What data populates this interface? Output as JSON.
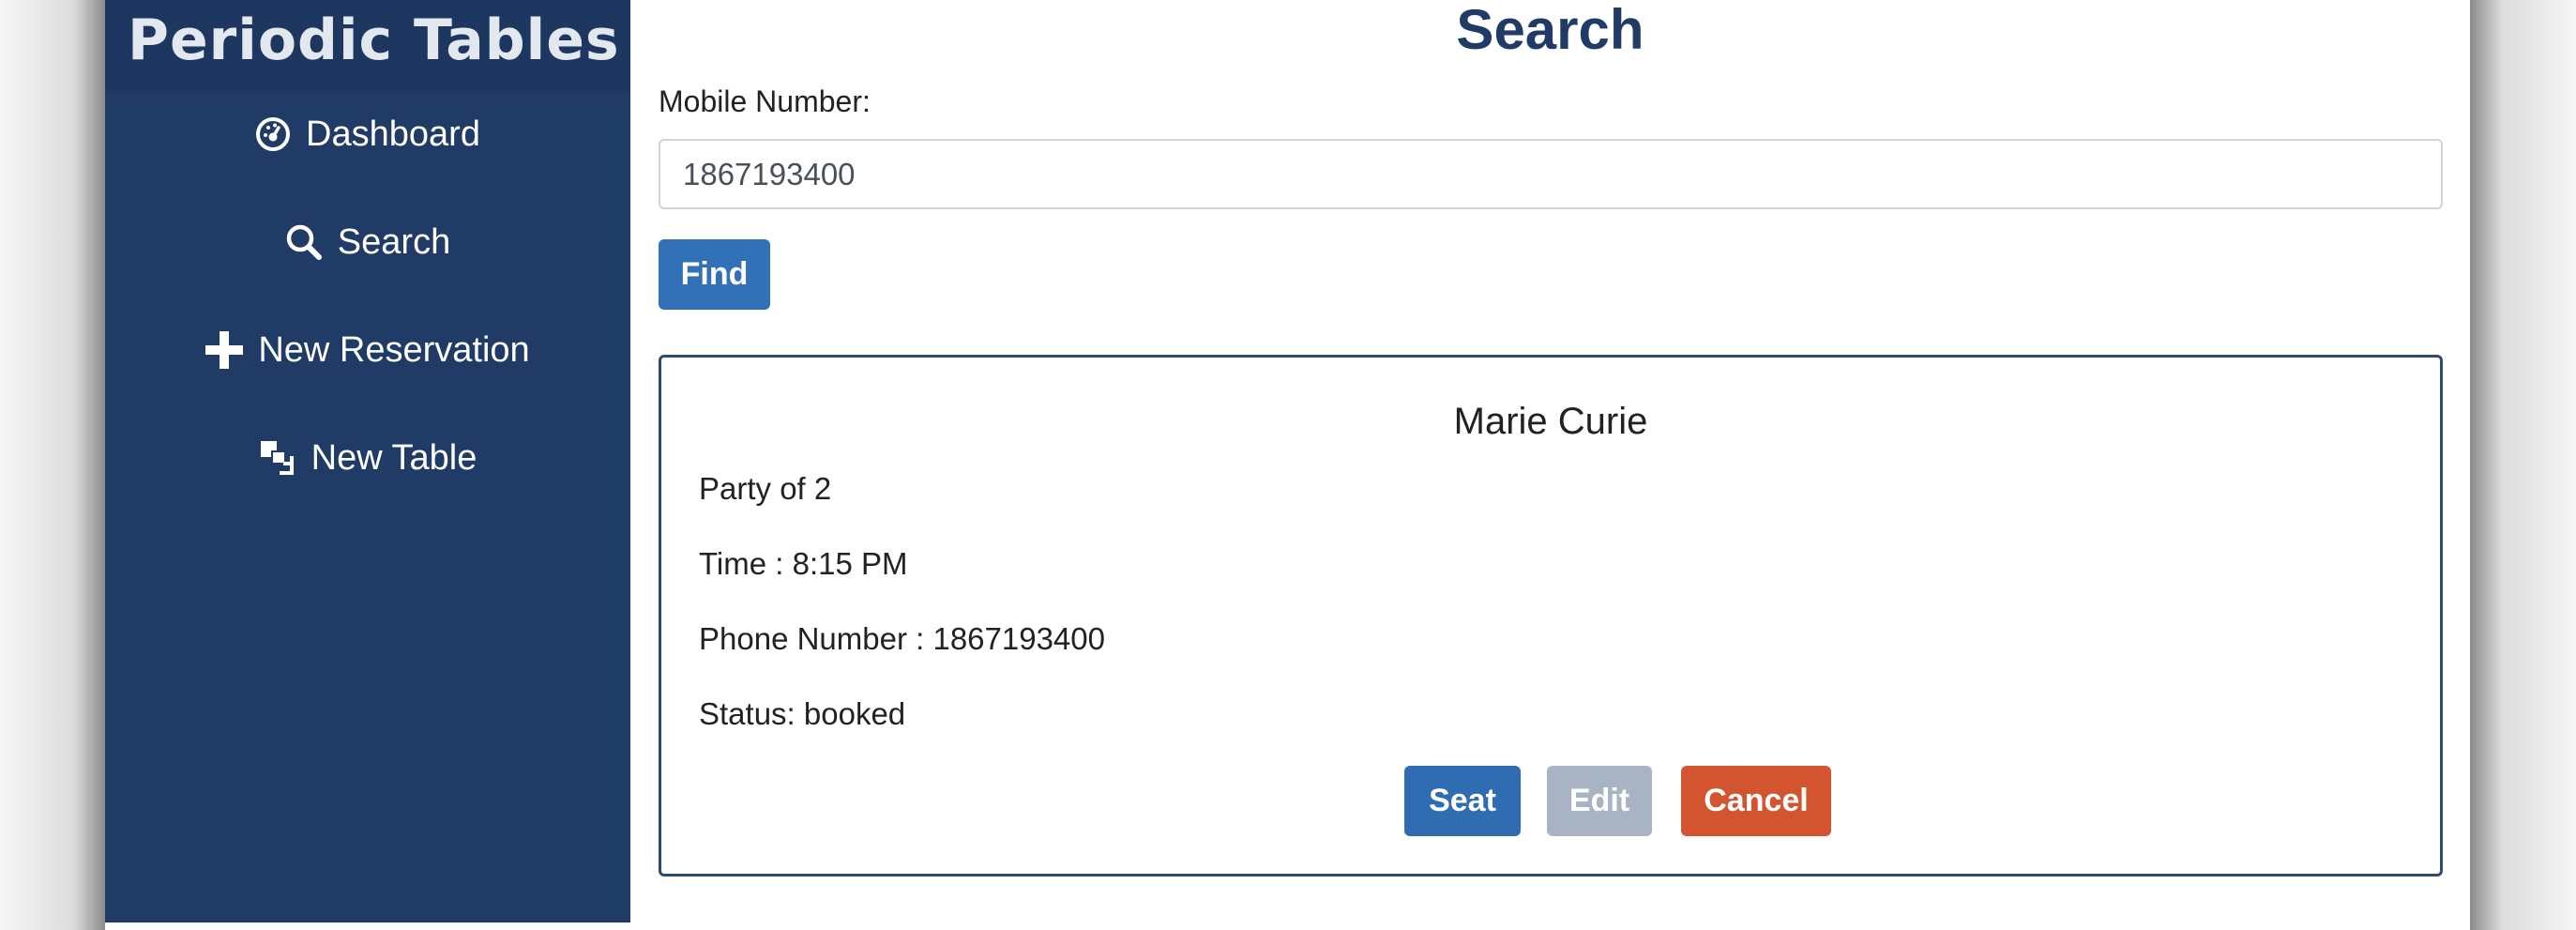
{
  "app": {
    "brand_title": "Periodic Tables"
  },
  "sidebar": {
    "items": [
      {
        "label": "Dashboard",
        "icon": "dashboard-icon"
      },
      {
        "label": "Search",
        "icon": "search-icon"
      },
      {
        "label": "New Reservation",
        "icon": "plus-icon"
      },
      {
        "label": "New Table",
        "icon": "new-table-icon"
      }
    ]
  },
  "page": {
    "title": "Search"
  },
  "search_form": {
    "label": "Mobile Number:",
    "value": "1867193400",
    "find_label": "Find"
  },
  "reservation": {
    "name": "Marie Curie",
    "party": "Party of 2",
    "time": "Time : 8:15 PM",
    "phone": "Phone Number : 1867193400",
    "status": "Status: booked",
    "seat_label": "Seat",
    "edit_label": "Edit",
    "cancel_label": "Cancel"
  },
  "colors": {
    "sidebar": "#1f3b66",
    "primary": "#3270b7",
    "disabled": "#a8b3c4",
    "danger": "#d2552f"
  }
}
